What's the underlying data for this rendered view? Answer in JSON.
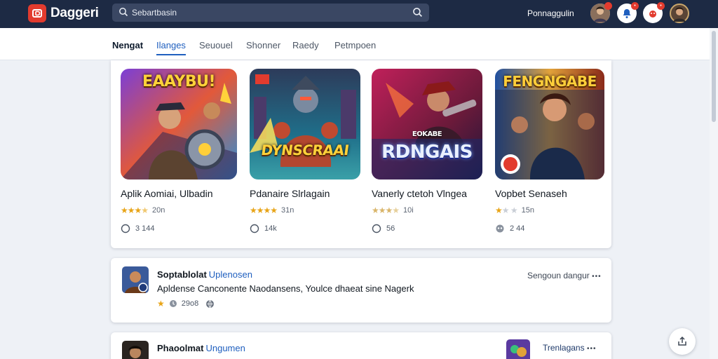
{
  "header": {
    "app_name": "Daggeri",
    "search_value": "Sebartbasin",
    "username": "Ponnaggulin",
    "notification_badge": "•",
    "alert_badge": "•"
  },
  "tabs": [
    {
      "label": "Nengat",
      "state": "active"
    },
    {
      "label": "Ilanges",
      "state": "selected"
    },
    {
      "label": "Seuouel",
      "state": "normal"
    },
    {
      "label": "Shonner",
      "state": "normal"
    },
    {
      "label": "Raedy",
      "state": "normal"
    },
    {
      "label": "Petmpoen",
      "state": "normal"
    }
  ],
  "games": [
    {
      "art_title": "EAAYBU!",
      "title": "Aplik Aomiai, Ulbadin",
      "rating": 3.5,
      "reviews": "20n",
      "count": "3 144",
      "count_icon": "clock-icon"
    },
    {
      "art_title": "DYNSCRAAI",
      "title": "Pdanaire Slrlagain",
      "rating": 4.5,
      "reviews": "31n",
      "count": "14k",
      "count_icon": "clock-icon"
    },
    {
      "art_title": "RDNGAIS",
      "title": "Vanerly ctetoh Vlngea",
      "rating": 3.5,
      "reviews": "10i",
      "count": "56",
      "count_icon": "clock-icon"
    },
    {
      "art_title": "FENGNGABE",
      "title": "Vopbet Senaseh",
      "rating": 1.5,
      "reviews": "15n",
      "count": "2 44",
      "count_icon": "gamepad-icon"
    }
  ],
  "feed": [
    {
      "name": "Soptablolat",
      "name_highlight": "Uplenosen",
      "body": "Apldense Canconente Naodansens, Youlce dhaeat sine Nagerk",
      "meta": "29o8",
      "right": "Sengoun dangur"
    },
    {
      "name": "Phaoolmat",
      "name_highlight": "Ungumen",
      "right": "Trenlagans"
    }
  ],
  "colors": {
    "header_bg": "#1d2a44",
    "accent_blue": "#1f5fbf",
    "brand_red": "#e23b2e",
    "star": "#e8a417"
  }
}
